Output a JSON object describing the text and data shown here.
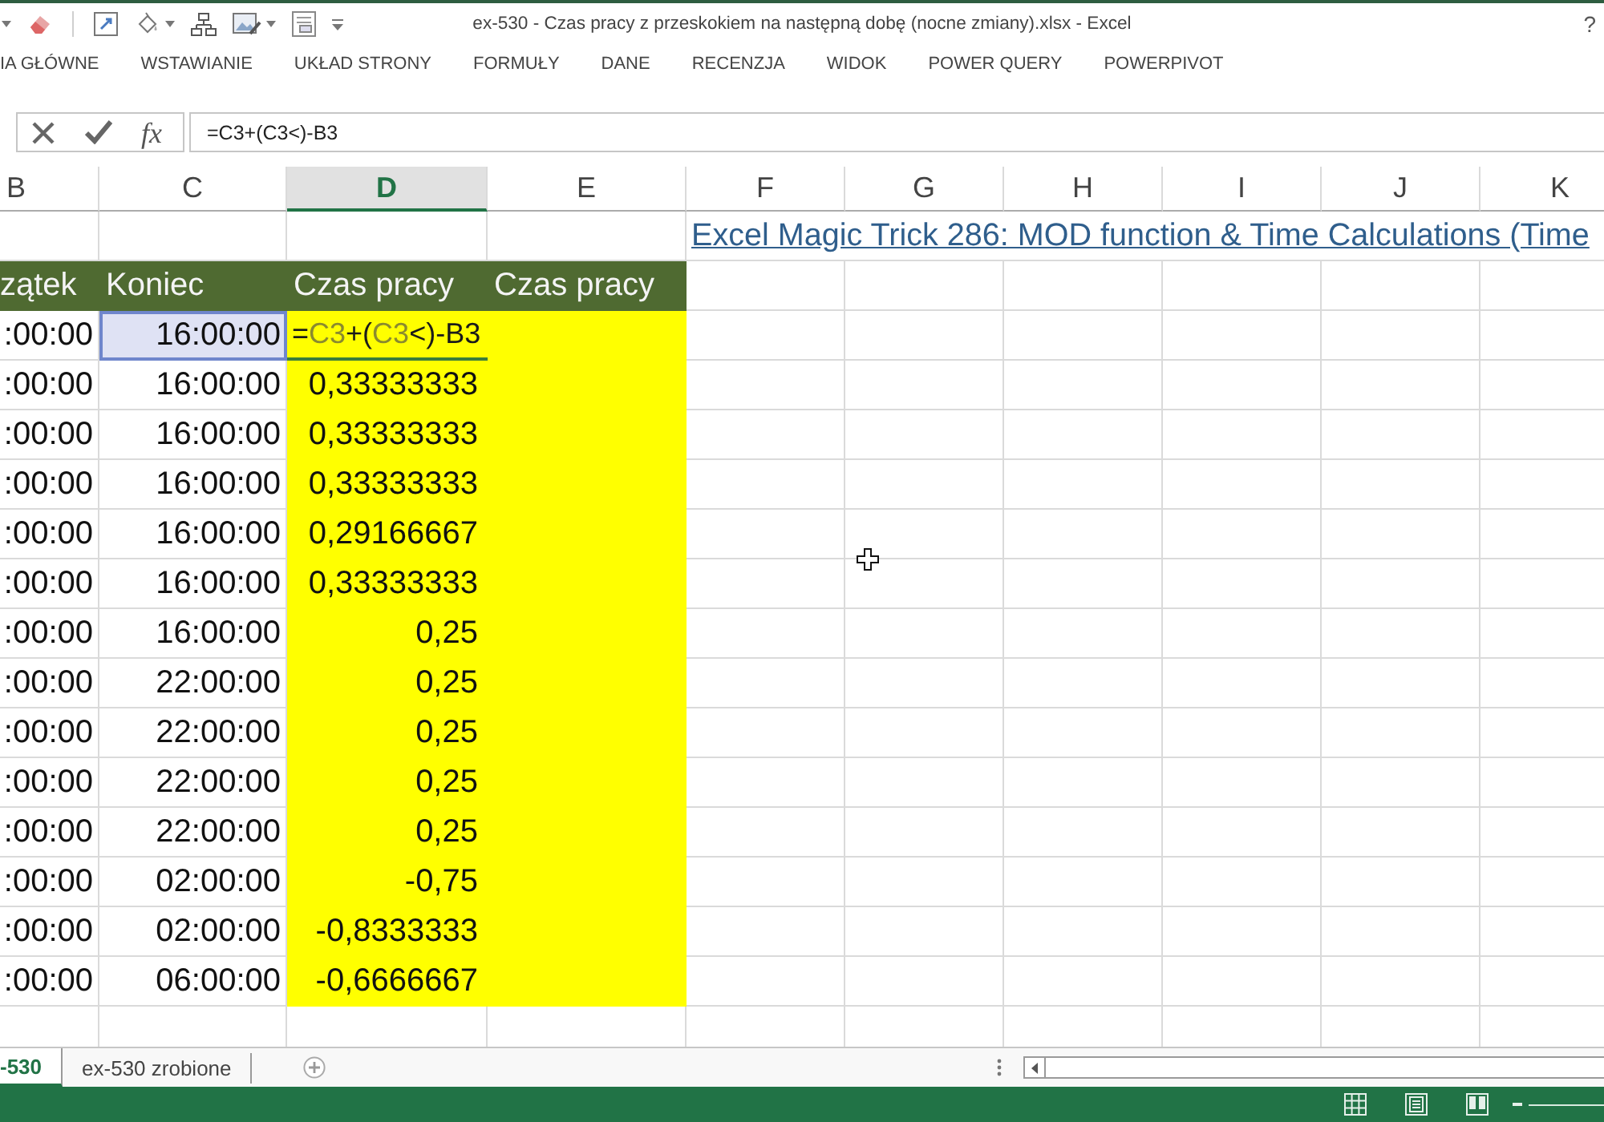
{
  "window": {
    "title": "ex-530 - Czas pracy z przeskokiem na następną dobę (nocne zmiany).xlsx - Excel",
    "help": "?"
  },
  "ribbon_tabs": [
    {
      "label": "IA GŁÓWNE",
      "selected": false
    },
    {
      "label": "WSTAWIANIE",
      "selected": false
    },
    {
      "label": "UKŁAD STRONY",
      "selected": false
    },
    {
      "label": "FORMUŁY",
      "selected": false
    },
    {
      "label": "DANE",
      "selected": false
    },
    {
      "label": "RECENZJA",
      "selected": false
    },
    {
      "label": "WIDOK",
      "selected": false
    },
    {
      "label": "POWER QUERY",
      "selected": false
    },
    {
      "label": "POWERPIVOT",
      "selected": false
    }
  ],
  "formula_bar": {
    "function_button": "fx",
    "value": "=C3+(C3<)-B3"
  },
  "sheet": {
    "columns": [
      {
        "label": "B",
        "selected": false
      },
      {
        "label": "C",
        "selected": false
      },
      {
        "label": "D",
        "selected": true
      },
      {
        "label": "E",
        "selected": false
      },
      {
        "label": "F",
        "selected": false
      },
      {
        "label": "G",
        "selected": false
      },
      {
        "label": "H",
        "selected": false
      },
      {
        "label": "I",
        "selected": false
      },
      {
        "label": "J",
        "selected": false
      },
      {
        "label": "K",
        "selected": false
      }
    ],
    "link": "Excel Magic Trick 286: MOD function & Time Calculations (Time",
    "headers": [
      "zątek",
      "Koniec",
      "Czas pracy",
      "Czas pracy"
    ],
    "rows": [
      {
        "start": ":00:00",
        "end": "16:00:00",
        "referenced": true,
        "formula": [
          {
            "kind": "text",
            "text": "="
          },
          {
            "kind": "reference",
            "text": "C3"
          },
          {
            "kind": "text",
            "text": "+("
          },
          {
            "kind": "reference",
            "text": "C3"
          },
          {
            "kind": "text",
            "text": "<)-B3"
          }
        ]
      },
      {
        "start": ":00:00",
        "end": "16:00:00",
        "referenced": false,
        "hours": "0,33333333"
      },
      {
        "start": ":00:00",
        "end": "16:00:00",
        "referenced": false,
        "hours": "0,33333333"
      },
      {
        "start": ":00:00",
        "end": "16:00:00",
        "referenced": false,
        "hours": "0,33333333"
      },
      {
        "start": ":00:00",
        "end": "16:00:00",
        "referenced": false,
        "hours": "0,29166667"
      },
      {
        "start": ":00:00",
        "end": "16:00:00",
        "referenced": false,
        "hours": "0,33333333"
      },
      {
        "start": ":00:00",
        "end": "16:00:00",
        "referenced": false,
        "hours": "0,25"
      },
      {
        "start": ":00:00",
        "end": "22:00:00",
        "referenced": false,
        "hours": "0,25"
      },
      {
        "start": ":00:00",
        "end": "22:00:00",
        "referenced": false,
        "hours": "0,25"
      },
      {
        "start": ":00:00",
        "end": "22:00:00",
        "referenced": false,
        "hours": "0,25"
      },
      {
        "start": ":00:00",
        "end": "22:00:00",
        "referenced": false,
        "hours": "0,25"
      },
      {
        "start": ":00:00",
        "end": "02:00:00",
        "referenced": false,
        "hours": "-0,75"
      },
      {
        "start": ":00:00",
        "end": "02:00:00",
        "referenced": false,
        "hours": "-0,8333333"
      },
      {
        "start": ":00:00",
        "end": "06:00:00",
        "referenced": false,
        "hours": "-0,6666667"
      }
    ]
  },
  "sheet_tabs": [
    {
      "label": "-530",
      "selected": true
    },
    {
      "label": "ex-530 zrobione",
      "selected": false
    }
  ]
}
